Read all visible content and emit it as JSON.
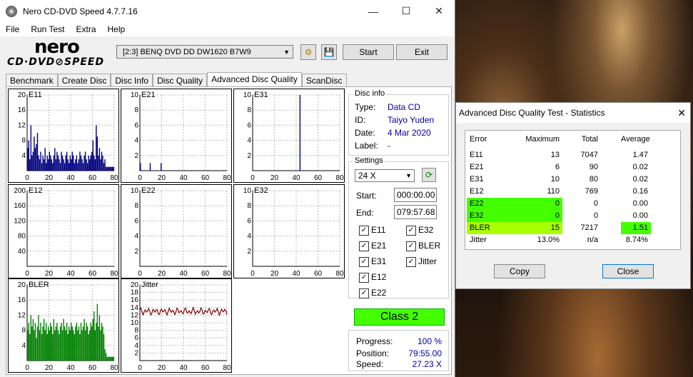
{
  "window": {
    "title": "Nero CD-DVD Speed 4.7.7.16"
  },
  "menu": [
    "File",
    "Run Test",
    "Extra",
    "Help"
  ],
  "logo": {
    "brand": "nero",
    "product": "CD·DVD⊘SPEED"
  },
  "toolbar": {
    "drive": "[2:3]   BENQ DVD DD DW1620 B7W9",
    "start": "Start",
    "exit": "Exit"
  },
  "tabs": [
    "Benchmark",
    "Create Disc",
    "Disc Info",
    "Disc Quality",
    "Advanced Disc Quality",
    "ScanDisc"
  ],
  "disc_info": {
    "title": "Disc info",
    "type_k": "Type:",
    "type_v": "Data CD",
    "id_k": "ID:",
    "id_v": "Taiyo Yuden",
    "date_k": "Date:",
    "date_v": "4 Mar 2020",
    "label_k": "Label:",
    "label_v": "-"
  },
  "settings": {
    "title": "Settings",
    "speed": "24 X",
    "start_k": "Start:",
    "start_v": "000:00.00",
    "end_k": "End:",
    "end_v": "079:57.68",
    "checks": [
      "E11",
      "E32",
      "E21",
      "BLER",
      "E31",
      "Jitter",
      "E12",
      "E22"
    ]
  },
  "class_label": "Class 2",
  "progress": {
    "progress_k": "Progress:",
    "progress_v": "100 %",
    "position_k": "Position:",
    "position_v": "79:55.00",
    "speed_k": "Speed:",
    "speed_v": "27.23 X"
  },
  "chart_data": [
    {
      "type": "bar",
      "name": "E11",
      "x_ticks": [
        0,
        20,
        40,
        60,
        80
      ],
      "y_ticks": [
        4,
        8,
        12,
        16,
        20
      ],
      "ylim": [
        0,
        20
      ],
      "color": "#000080",
      "values": [
        6,
        8,
        3,
        12,
        4,
        5,
        9,
        6,
        7,
        10,
        4,
        3,
        5,
        2,
        4,
        3,
        6,
        2,
        4,
        3,
        5,
        4,
        3,
        2,
        4,
        6,
        3,
        5,
        4,
        3,
        2,
        5,
        4,
        3,
        2,
        4,
        5,
        3,
        2,
        4,
        3,
        5,
        4,
        2,
        3,
        4,
        2,
        3,
        5,
        4,
        3,
        2,
        4,
        5,
        3,
        2,
        4,
        3,
        4,
        5,
        8,
        4,
        3,
        12,
        9,
        4,
        6,
        3,
        5,
        4,
        2,
        3,
        1,
        1,
        1,
        1,
        1,
        1,
        1,
        1
      ]
    },
    {
      "type": "bar",
      "name": "E21",
      "x_ticks": [
        0,
        20,
        40,
        60,
        80
      ],
      "y_ticks": [
        2,
        4,
        6,
        8,
        10
      ],
      "ylim": [
        0,
        10
      ],
      "color": "#000080",
      "values": [
        1,
        0,
        0,
        0,
        0,
        0,
        0,
        0,
        0,
        1,
        0,
        0,
        0,
        0,
        0,
        0,
        0,
        0,
        0,
        1,
        0,
        0,
        0,
        0,
        0,
        0,
        0,
        0,
        0,
        0,
        0,
        0,
        0,
        0,
        0,
        0,
        0,
        0,
        0,
        0,
        0,
        0,
        0,
        0,
        0,
        0,
        0,
        0,
        0,
        0,
        0,
        0,
        0,
        0,
        0,
        0,
        0,
        0,
        0,
        0,
        0,
        0,
        0,
        0,
        0,
        0,
        0,
        0,
        0,
        0,
        0,
        0,
        0,
        0,
        0,
        0,
        0,
        0,
        0,
        0
      ]
    },
    {
      "type": "bar",
      "name": "E31",
      "x_ticks": [
        0,
        20,
        40,
        60,
        80
      ],
      "y_ticks": [
        2,
        4,
        6,
        8,
        10
      ],
      "ylim": [
        0,
        10
      ],
      "color": "#000080",
      "values": [
        0,
        0,
        0,
        0,
        0,
        0,
        0,
        0,
        0,
        0,
        0,
        0,
        0,
        0,
        0,
        0,
        0,
        0,
        0,
        0,
        0,
        0,
        0,
        0,
        0,
        0,
        0,
        0,
        0,
        0,
        0,
        0,
        0,
        0,
        0,
        0,
        0,
        0,
        0,
        0,
        0,
        0,
        0,
        10,
        0,
        0,
        0,
        0,
        0,
        0,
        0,
        0,
        0,
        0,
        0,
        0,
        0,
        0,
        0,
        0,
        0,
        0,
        0,
        0,
        0,
        0,
        0,
        0,
        0,
        0,
        0,
        0,
        0,
        0,
        0,
        0,
        0,
        0,
        0,
        0
      ]
    },
    {
      "type": "bar",
      "name": "E12",
      "x_ticks": [
        0,
        20,
        40,
        60,
        80
      ],
      "y_ticks": [
        40,
        80,
        120,
        160,
        200
      ],
      "ylim": [
        0,
        200
      ],
      "color": "#800080",
      "values": [
        0,
        0,
        0,
        0,
        0,
        0,
        0,
        0,
        0,
        0,
        0,
        0,
        0,
        0,
        0,
        0,
        0,
        0,
        0,
        0,
        0,
        0,
        0,
        0,
        0,
        0,
        0,
        0,
        0,
        0,
        0,
        0,
        0,
        0,
        0,
        0,
        0,
        0,
        0,
        0,
        0,
        0,
        0,
        0,
        0,
        0,
        0,
        0,
        0,
        0,
        0,
        0,
        0,
        0,
        0,
        0,
        0,
        0,
        0,
        0,
        0,
        0,
        0,
        0,
        0,
        0,
        0,
        0,
        0,
        0,
        0,
        0,
        0,
        0,
        0,
        0,
        0,
        0,
        0,
        0
      ]
    },
    {
      "type": "bar",
      "name": "E22",
      "x_ticks": [
        0,
        20,
        40,
        60,
        80
      ],
      "y_ticks": [
        2,
        4,
        6,
        8,
        10
      ],
      "ylim": [
        0,
        10
      ],
      "color": "#000080",
      "values": []
    },
    {
      "type": "bar",
      "name": "E32",
      "x_ticks": [
        0,
        20,
        40,
        60,
        80
      ],
      "y_ticks": [
        2,
        4,
        6,
        8,
        10
      ],
      "ylim": [
        0,
        10
      ],
      "color": "#000080",
      "values": []
    },
    {
      "type": "bar",
      "name": "BLER",
      "x_ticks": [
        0,
        20,
        40,
        60,
        80
      ],
      "y_ticks": [
        4,
        8,
        12,
        16,
        20
      ],
      "ylim": [
        0,
        20
      ],
      "color": "#008000",
      "values": [
        8,
        10,
        7,
        12,
        9,
        11,
        8,
        10,
        6,
        9,
        12,
        8,
        10,
        7,
        9,
        11,
        8,
        10,
        7,
        9,
        8,
        10,
        9,
        7,
        11,
        8,
        9,
        10,
        8,
        7,
        9,
        10,
        8,
        11,
        9,
        8,
        10,
        7,
        9,
        8,
        10,
        9,
        8,
        7,
        9,
        10,
        8,
        9,
        7,
        10,
        8,
        9,
        11,
        8,
        10,
        9,
        7,
        8,
        10,
        9,
        11,
        13,
        8,
        10,
        15,
        9,
        12,
        8,
        10,
        9,
        7,
        3,
        2,
        1,
        1,
        1,
        1,
        1,
        1,
        1
      ]
    },
    {
      "type": "line",
      "name": "Jitter",
      "x_ticks": [
        0,
        20,
        40,
        60,
        80
      ],
      "y_ticks": [
        2,
        4,
        6,
        8,
        10,
        12,
        14,
        16,
        18,
        20
      ],
      "ylim": [
        0,
        20
      ],
      "color": "#800000",
      "level": 13.0
    }
  ],
  "stats": {
    "title": "Advanced Disc Quality Test - Statistics",
    "headers": [
      "Error",
      "Maximum",
      "Total",
      "Average"
    ],
    "rows": [
      [
        "E11",
        "13",
        "7047",
        "1.47"
      ],
      [
        "E21",
        "6",
        "90",
        "0.02"
      ],
      [
        "E31",
        "10",
        "80",
        "0.02"
      ],
      [
        "E12",
        "110",
        "769",
        "0.16"
      ],
      [
        "E22",
        "0",
        "0",
        "0.00"
      ],
      [
        "E32",
        "0",
        "0",
        "0.00"
      ],
      [
        "BLER",
        "15",
        "7217",
        "1.51"
      ],
      [
        "Jitter",
        "13.0%",
        "n/a",
        "8.74%"
      ]
    ],
    "copy": "Copy",
    "close": "Close"
  }
}
